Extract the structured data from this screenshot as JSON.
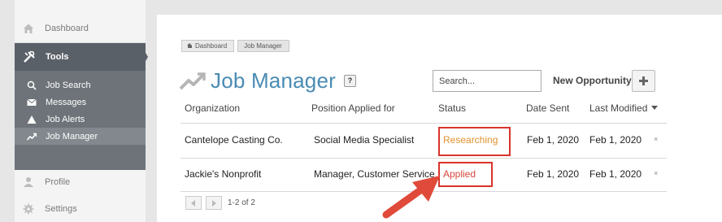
{
  "sidebar": {
    "dashboard": "Dashboard",
    "tools": "Tools",
    "sub_items": [
      {
        "label": "Job Search",
        "icon": "search-icon"
      },
      {
        "label": "Messages",
        "icon": "envelope-icon"
      },
      {
        "label": "Job Alerts",
        "icon": "warning-icon"
      },
      {
        "label": "Job Manager",
        "icon": "trending-up-icon"
      }
    ],
    "profile": "Profile",
    "settings": "Settings"
  },
  "breadcrumb": {
    "home": "Dashboard",
    "current": "Job Manager"
  },
  "main": {
    "title": "Job Manager",
    "help": "?",
    "search_placeholder": "Search...",
    "new_opportunity": "New Opportunity"
  },
  "table": {
    "columns": [
      "Organization",
      "Position Applied for",
      "Status",
      "Date Sent",
      "Last Modified"
    ],
    "rows": [
      {
        "organization": "Cantelope Casting Co.",
        "position": "Social Media Specialist",
        "status": "Researching",
        "date_sent": "Feb 1, 2020",
        "last_modified": "Feb 1, 2020",
        "remove": "×"
      },
      {
        "organization": "Jackie's Nonprofit",
        "position": "Manager, Customer Service",
        "status": "Applied",
        "date_sent": "Feb 1, 2020",
        "last_modified": "Feb 1, 2020",
        "remove": "×"
      }
    ]
  },
  "pager": {
    "count": "1-2 of 2"
  },
  "colors": {
    "title_blue": "#4a8bb3",
    "researching": "#e0912c",
    "applied": "#d6453d",
    "highlight_box": "#d9342b",
    "arrow": "#e04a3a"
  }
}
